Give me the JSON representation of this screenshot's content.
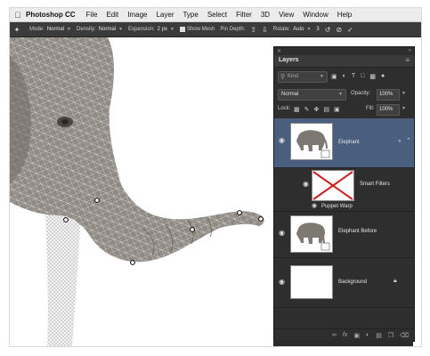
{
  "menubar": {
    "app": "Photoshop CC",
    "items": [
      "File",
      "Edit",
      "Image",
      "Layer",
      "Type",
      "Select",
      "Filter",
      "3D",
      "View",
      "Window",
      "Help"
    ]
  },
  "options": {
    "mode_label": "Mode:",
    "mode_value": "Normal",
    "density_label": "Density:",
    "density_value": "Normal",
    "expansion_label": "Expansion:",
    "expansion_value": "2 px",
    "show_mesh_label": "Show Mesh",
    "show_mesh_checked": true,
    "pin_depth_label": "Pin Depth:",
    "rotate_label": "Rotate:",
    "rotate_value": "Auto",
    "rotate_degrees": "3"
  },
  "layers_panel": {
    "title": "Layers",
    "kind_label": "Kind",
    "blend_mode": "Normal",
    "opacity_label": "Opacity:",
    "opacity_value": "100%",
    "lock_label": "Lock:",
    "fill_label": "Fill:",
    "fill_value": "100%",
    "layers": [
      {
        "name": "Elephant",
        "selected": true
      },
      {
        "name": "Smart Filters"
      },
      {
        "name": "Puppet Warp"
      },
      {
        "name": "Elephant Before"
      },
      {
        "name": "Background",
        "locked": true
      }
    ]
  },
  "colors": {
    "selection": "#4a5f7e",
    "panel_bg": "#2e2e2e",
    "options_bg": "#3b3b3b",
    "menubar_bg": "#ececec",
    "filter_x": "#cc1f1f"
  }
}
